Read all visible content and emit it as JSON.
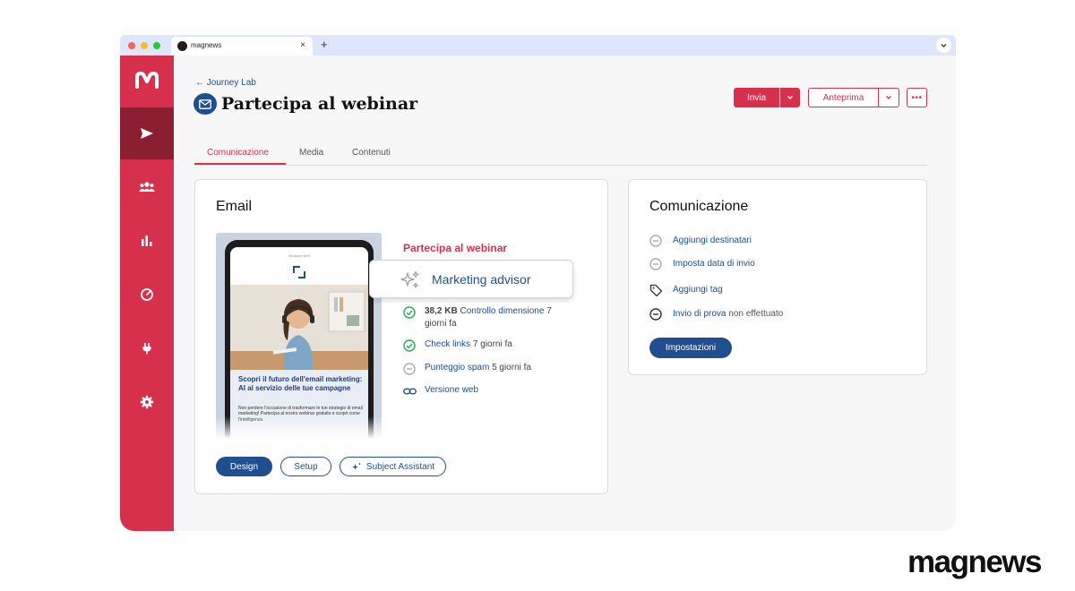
{
  "browser": {
    "tab_title": "magnews",
    "tab_close": "×",
    "new_tab": "+",
    "traffic_lights": [
      "#ff5f57",
      "#febc2e",
      "#28c840"
    ]
  },
  "sidebar": {
    "items": [
      {
        "icon": "send-icon",
        "active": true
      },
      {
        "icon": "users-icon",
        "active": false
      },
      {
        "icon": "bar-chart-icon",
        "active": false
      },
      {
        "icon": "speedometer-icon",
        "active": false
      },
      {
        "icon": "plug-icon",
        "active": false
      },
      {
        "icon": "gear-icon",
        "active": false
      }
    ]
  },
  "header": {
    "breadcrumb": "← Journey Lab",
    "title": "Partecipa al webinar",
    "send_label": "Invia",
    "preview_label": "Anteprima",
    "more_label": "•••"
  },
  "tabs": [
    "Comunicazione",
    "Media",
    "Contenuti"
  ],
  "email_card": {
    "title": "Email",
    "preview": {
      "top_text": "Versione web",
      "headline": "Scopri il futuro dell'email marketing: AI al servizio delle tue campagne",
      "body": "Non perdere l'occasione di trasformare le tue strategie di email marketing! Partecipa al nostro webinar gratuito e scopri come l'intelligenza"
    },
    "heading": "Partecipa al webinar",
    "advisor_label": "Marketing advisor",
    "checks": [
      {
        "status": "ok",
        "bold": "38,2 KB",
        "link": "Controllo dimensione",
        "suffix": "7",
        "line2": "giorni fa"
      },
      {
        "status": "ok",
        "link": "Check links",
        "suffix": "7 giorni fa"
      },
      {
        "status": "neutral",
        "link": "Punteggio spam",
        "suffix": "5 giorni fa"
      },
      {
        "status": "link",
        "link": "Versione web",
        "suffix": ""
      }
    ],
    "buttons": {
      "design": "Design",
      "setup": "Setup",
      "subject": "Subject Assistant"
    }
  },
  "comunicazione_card": {
    "title": "Comunicazione",
    "rows": [
      {
        "icon": "minus-circle-icon",
        "label": "Aggiungi destinatari",
        "muted": ""
      },
      {
        "icon": "minus-circle-icon",
        "label": "Imposta data di invio",
        "muted": ""
      },
      {
        "icon": "tag-icon",
        "label": "Aggiungi tag",
        "muted": ""
      },
      {
        "icon": "minus-circle-icon",
        "label": "Invio di prova",
        "muted": "non effettuato"
      }
    ],
    "settings_label": "Impostazioni"
  },
  "brand": "magnews",
  "colors": {
    "accent": "#d7304d",
    "accent_dark": "#8b1e31",
    "link": "#1f4f8f",
    "ok": "#2aa55a"
  }
}
